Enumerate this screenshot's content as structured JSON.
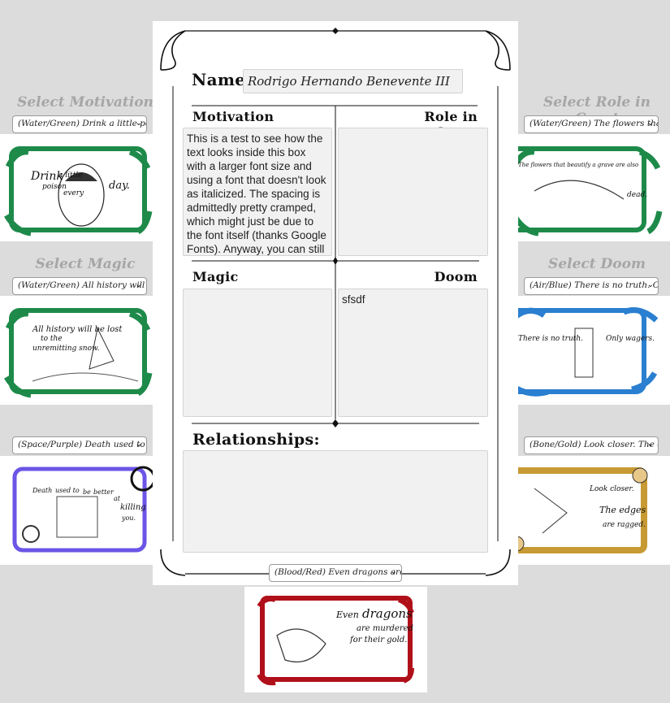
{
  "left": {
    "motivation": {
      "label": "Select Motivation",
      "selected": "(Water/Green) Drink a little poison every day."
    },
    "magic": {
      "label": "Select Magic",
      "selected": "(Water/Green) All history will be lost to the unremitting snow."
    },
    "extra": {
      "selected": "(Space/Purple) Death used to be better at killing you."
    }
  },
  "right": {
    "role": {
      "label": "Select Role in Court",
      "selected": "(Water/Green) The flowers that beautify a grave are also dead."
    },
    "doom": {
      "label": "Select Doom",
      "selected": "(Air/Blue) There is no truth. Only wagers."
    },
    "extra": {
      "selected": "(Bone/Gold) Look closer. The edges are ragged."
    }
  },
  "bottom": {
    "selected": "(Blood/Red) Even dragons are murdered for their gold."
  },
  "sheet": {
    "name_label": "Name:",
    "name_value": "Rodrigo Hernando Benevente III",
    "motivation_label": "Motivation",
    "role_label": "Role in Court",
    "magic_label": "Magic",
    "doom_label": "Doom",
    "relationships_label": "Relationships:",
    "motivation_text": "This is a test to see how the text looks inside this box with a larger font size and using a font that doesn't look as italicized. The spacing is admittedly pretty cramped, which might just be due to the font itself (thanks Google Fonts). Anyway, you can still scroll down to view",
    "role_text": "",
    "magic_text": "",
    "doom_text": "sfsdf",
    "relationships_text": ""
  },
  "cards": {
    "motivation": {
      "words": [
        "Drink",
        "a little",
        "poison",
        "every",
        "day."
      ],
      "color": "#1e8a4a"
    },
    "role": {
      "words": [
        "The flowers that beautify a grave are also",
        "dead."
      ],
      "color": "#1e8a4a"
    },
    "magic": {
      "words": [
        "All history will be lost",
        "to the",
        "unremitting snow."
      ],
      "color": "#1e8a4a"
    },
    "doom": {
      "words": [
        "There is no truth.",
        "Only wagers."
      ],
      "color": "#2a7fd0"
    },
    "extra_left": {
      "words": [
        "Death",
        "used to",
        "be",
        "better",
        "at",
        "killing",
        "you."
      ],
      "color": "#6b55e6"
    },
    "extra_right": {
      "words": [
        "Look closer.",
        "The edges",
        "are ragged."
      ],
      "color": "#c79a33"
    },
    "bottom": {
      "words": [
        "Even",
        "dragons",
        "are murdered",
        "for their gold."
      ],
      "color": "#b0101a"
    }
  }
}
